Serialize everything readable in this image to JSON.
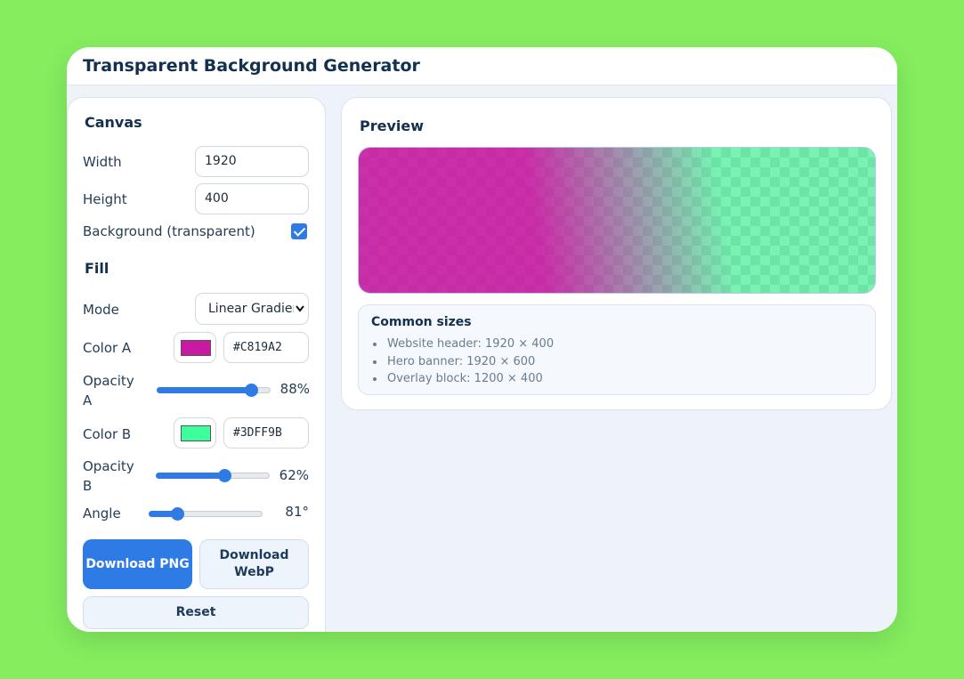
{
  "app": {
    "title": "Transparent Background Generator"
  },
  "canvas": {
    "title": "Canvas",
    "width_label": "Width",
    "width_value": "1920",
    "height_label": "Height",
    "height_value": "400",
    "background_label": "Background (transparent)",
    "background_checked": true
  },
  "fill": {
    "title": "Fill",
    "mode_label": "Mode",
    "mode_value": "Linear Gradient",
    "color_a_label": "Color A",
    "color_a_hex": "#C819A2",
    "opacity_a_label_1": "Opacity",
    "opacity_a_label_2": "A",
    "opacity_a_value": "88%",
    "opacity_a_fraction": 0.88,
    "color_b_label": "Color B",
    "color_b_hex": "#3DFF9B",
    "opacity_b_label_1": "Opacity",
    "opacity_b_label_2": "B",
    "opacity_b_value": "62%",
    "opacity_b_fraction": 0.62,
    "angle_label": "Angle",
    "angle_value": "81°",
    "angle_degrees": 81,
    "angle_max": 360
  },
  "buttons": {
    "download_png": "Download PNG",
    "download_webp": "Download WebP",
    "reset": "Reset"
  },
  "preview": {
    "title": "Preview",
    "common_sizes_title": "Common sizes",
    "common_sizes": [
      "Website header: 1920 × 400",
      "Hero banner: 1920 × 600",
      "Overlay block: 1200 × 400"
    ]
  },
  "colors": {
    "accent": "#2f7be5",
    "page_bg": "#84ee5f"
  }
}
